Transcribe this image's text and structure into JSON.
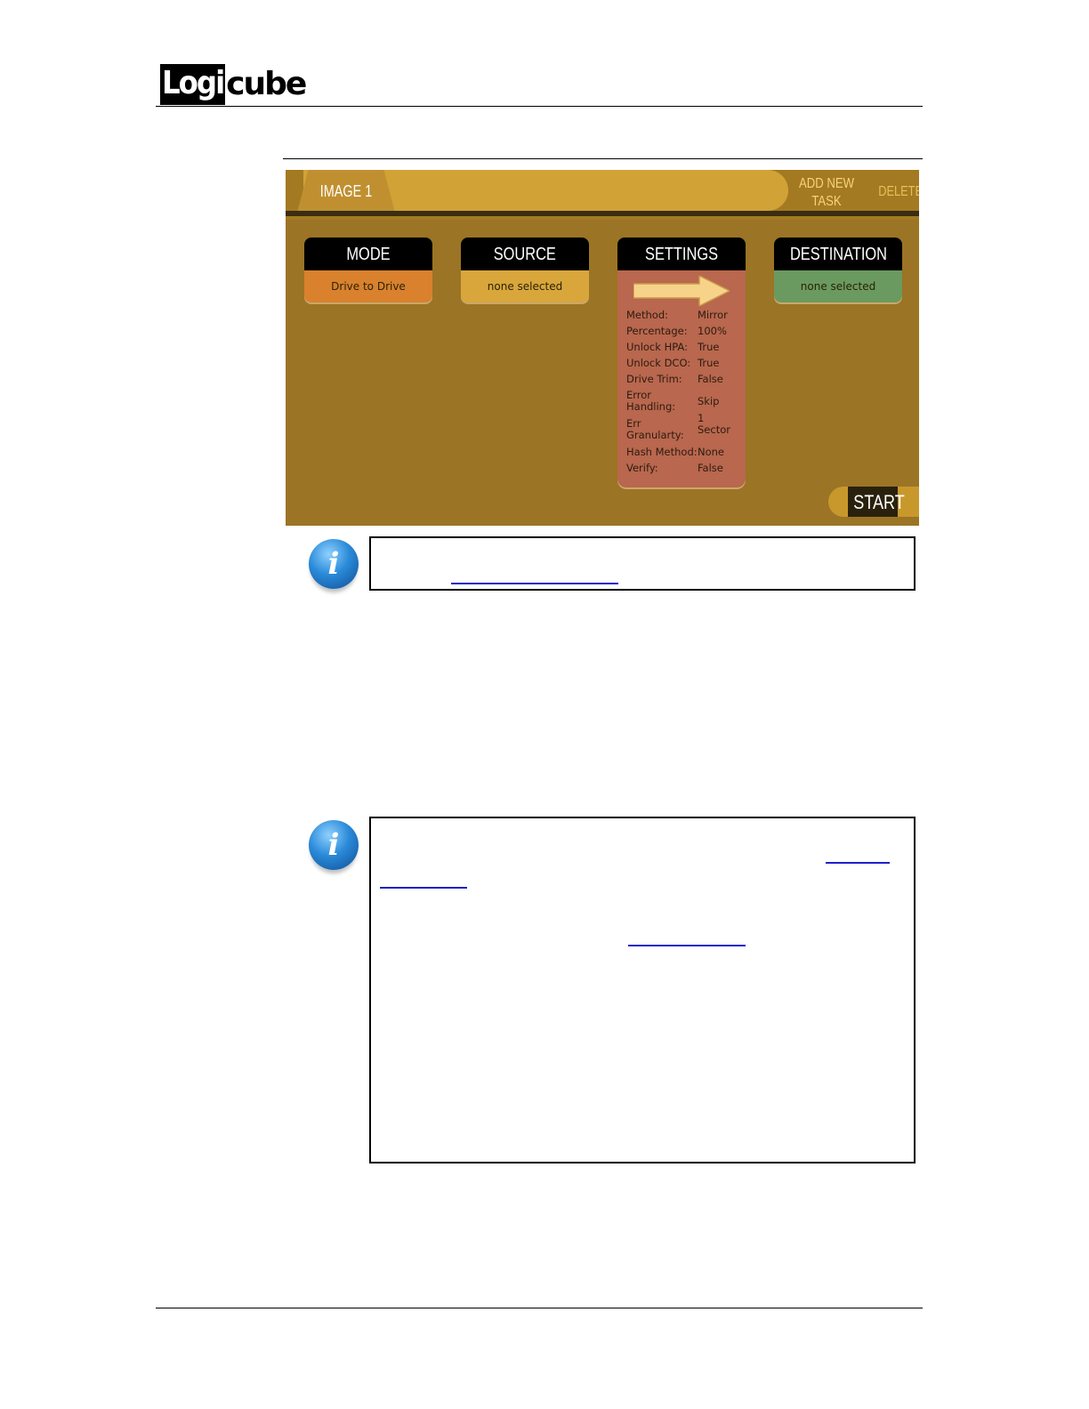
{
  "header": {
    "logo_boxed": "Logi",
    "logo_rest": "cube"
  },
  "screen": {
    "tab_label": "IMAGE 1",
    "add_task_line1": "ADD NEW",
    "add_task_line2": "TASK",
    "delete_label": "DELETE",
    "mode": {
      "title": "MODE",
      "value": "Drive to Drive",
      "color": "#d9812d"
    },
    "source": {
      "title": "SOURCE",
      "value": "none selected",
      "color": "#d8a63b"
    },
    "settings": {
      "title": "SETTINGS",
      "rows": [
        {
          "key": "Method:",
          "value": "Mirror"
        },
        {
          "key": "Percentage:",
          "value": "100%"
        },
        {
          "key": "Unlock HPA:",
          "value": "True"
        },
        {
          "key": "Unlock DCO:",
          "value": "True"
        },
        {
          "key": "Drive Trim:",
          "value": "False"
        },
        {
          "key": "Error Handling:",
          "value": "Skip"
        },
        {
          "key": "Err Granularty:",
          "value": "1 Sector"
        },
        {
          "key": "Hash Method:",
          "value": "None"
        },
        {
          "key": "Verify:",
          "value": "False"
        }
      ]
    },
    "destination": {
      "title": "DESTINATION",
      "value": "none selected",
      "color": "#6a9a5f"
    },
    "start_label": "START"
  },
  "icons": {
    "info": "info-icon",
    "arrow": "right-arrow-icon"
  },
  "colors": {
    "screen_bg": "#9b7425",
    "tab_strip": "#d1a236",
    "settings_bg": "#b9674e",
    "link": "#1f1fcc"
  }
}
